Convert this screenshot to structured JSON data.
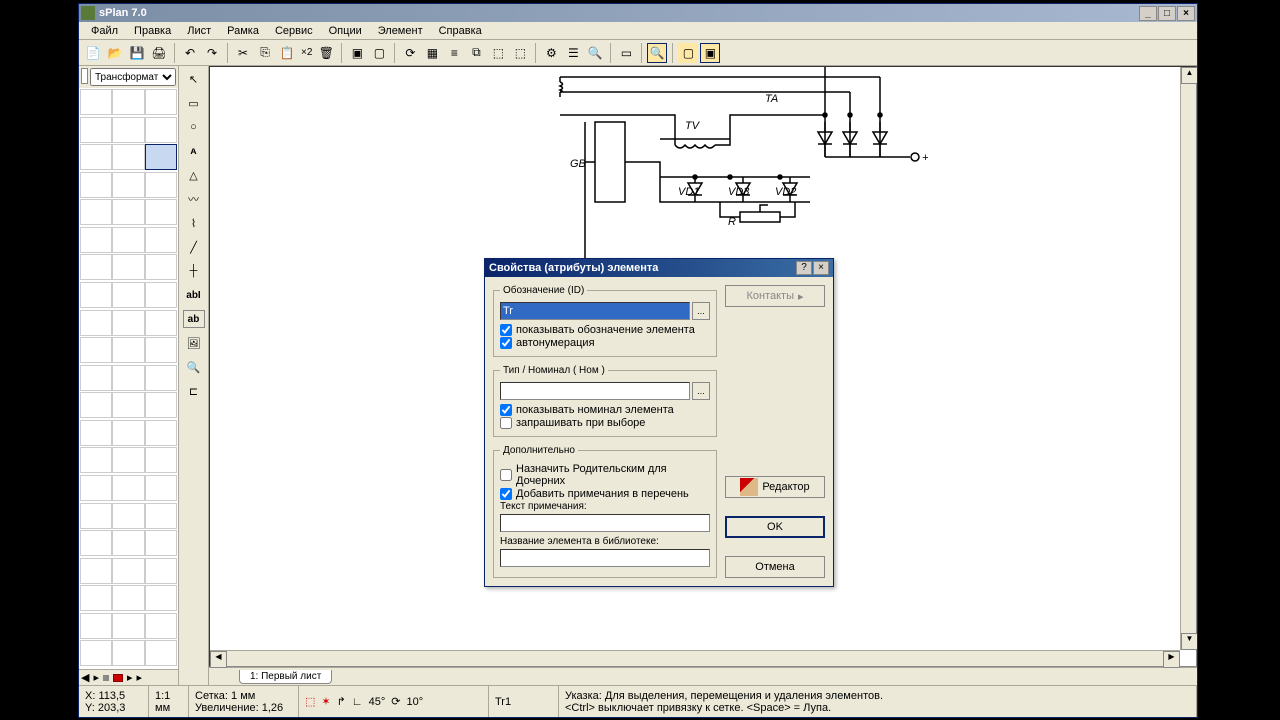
{
  "app": {
    "title": "sPlan 7.0"
  },
  "menu": [
    "Файл",
    "Правка",
    "Лист",
    "Рамка",
    "Сервис",
    "Опции",
    "Элемент",
    "Справка"
  ],
  "library": {
    "selected": "Трансформат"
  },
  "tab": {
    "label": "1: Первый лист"
  },
  "toolbar": {
    "zoom_x2": "×2"
  },
  "statusbar": {
    "x": "X: 113,5",
    "y": "Y: 203,3",
    "scale": "1:1",
    "unit": "мм",
    "grid": "Сетка: 1 мм",
    "zoom": "Увеличение: 1,26",
    "angle1": "45°",
    "angle2": "10°",
    "elem": "Tr1",
    "hint1": "Указка: Для выделения, перемещения и удаления элементов.",
    "hint2": "<Ctrl> выключает привязку к сетке. <Space> = Лупа."
  },
  "schematic": {
    "labels": {
      "ta": "TA",
      "tv": "TV",
      "gb": "GB",
      "vd1": "VD1",
      "vd3": "VD3",
      "vd2": "VD2",
      "r": "R",
      "plus": "+"
    }
  },
  "dialog": {
    "title": "Свойства (атрибуты) элемента",
    "group_id": "Обозначение (ID)",
    "id_value": "Tr",
    "chk_show_id": "показывать обозначение элемента",
    "chk_autonum": "автонумерация",
    "group_type": "Тип / Номинал ( Ном )",
    "type_value": "",
    "chk_show_nom": "показывать номинал элемента",
    "chk_ask": "запрашивать при выборе",
    "group_extra": "Дополнительно",
    "chk_parent": "Назначить Родительским для Дочерних",
    "chk_addnote": "Добавить примечания в перечень",
    "lbl_note": "Текст примечания:",
    "note_value": "",
    "lbl_libname": "Название элемента в библиотеке:",
    "libname_value": "",
    "btn_contacts": "Контакты",
    "btn_editor": "Редактор",
    "btn_ok": "OK",
    "btn_cancel": "Отмена"
  }
}
